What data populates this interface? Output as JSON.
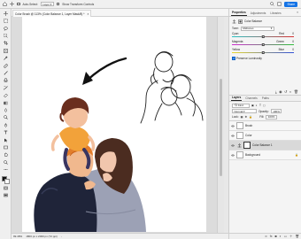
{
  "options_bar": {
    "auto_select_label": "Auto-Select:",
    "layer_select_value": "Layer",
    "transform_label": "Show Transform Controls",
    "share_label": "Share"
  },
  "document_tab": {
    "title": "Color Brush @ 113% (Color Balance 1, Layer Mask/8) *",
    "close": "×"
  },
  "status_bar": {
    "zoom": "99.48%",
    "dimensions": "1800 px x 2000 px (72 ppi)"
  },
  "properties_panel": {
    "tabs": [
      "Properties",
      "Adjustments",
      "Libraries"
    ],
    "adjustment_title": "Color Balance",
    "tone_label": "Tone:",
    "tone_value": "Midtones",
    "sliders": [
      {
        "left": "Cyan",
        "right": "Red",
        "value": "0",
        "position": 0.5,
        "from": "#27c4c4",
        "to": "#d83030"
      },
      {
        "left": "Magenta",
        "right": "Green",
        "value": "0",
        "position": 0.5,
        "from": "#d02bd0",
        "to": "#2fbf3a"
      },
      {
        "left": "Yellow",
        "right": "Blue",
        "value": "0",
        "position": 0.5,
        "from": "#e8d82a",
        "to": "#2f4fd8"
      }
    ],
    "preserve_label": "Preserve Luminosity"
  },
  "layers_panel": {
    "tabs": [
      "Layers",
      "Channels",
      "Paths"
    ],
    "kind_label": "Kind",
    "blend_value": "Normal",
    "opacity_label": "Opacity:",
    "opacity_value": "100%",
    "lock_label": "Lock:",
    "fill_label": "Fill:",
    "fill_value": "100%",
    "layers": [
      {
        "name": "Brush",
        "selected": false
      },
      {
        "name": "Color",
        "selected": false
      },
      {
        "name": "Color Balance 1",
        "selected": true
      },
      {
        "name": "Background",
        "selected": false
      }
    ]
  }
}
